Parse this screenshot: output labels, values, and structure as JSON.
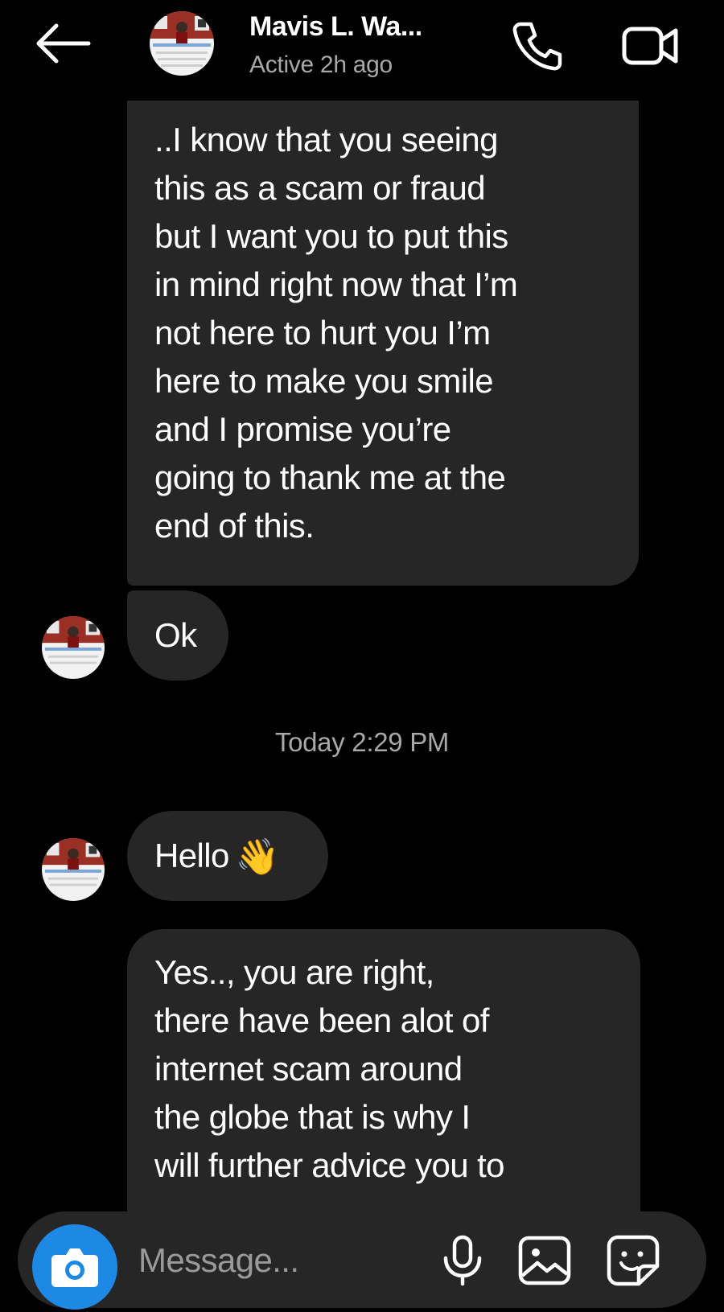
{
  "header": {
    "contact_name": "Mavis L. Wa...",
    "status": "Active 2h ago"
  },
  "icons": {
    "back": "arrow-left-icon",
    "call": "phone-icon",
    "video": "video-camera-icon",
    "camera": "camera-icon",
    "mic": "microphone-icon",
    "gallery": "image-icon",
    "sticker": "sticker-icon"
  },
  "messages": [
    {
      "sender": "contact",
      "lines": [
        "..I know that you seeing",
        "this as a scam or fraud",
        "but I want you to put this",
        "in mind right now that I’m",
        "not here to hurt you I’m",
        "here to make you smile",
        "and I promise you’re",
        "going to thank me at the",
        "end of this."
      ]
    },
    {
      "sender": "contact",
      "text": "Ok"
    },
    {
      "sender": "contact",
      "text": "Hello",
      "emoji": "👋"
    },
    {
      "sender": "contact",
      "lines": [
        "Yes.., you are right,",
        "there have been alot of",
        "internet scam around",
        "the globe that is why I",
        "will further advice you to"
      ]
    }
  ],
  "timestamp": "Today 2:29 PM",
  "composer": {
    "placeholder": "Message..."
  },
  "colors": {
    "background": "#000000",
    "bubble": "#262626",
    "accent": "#1e88e5",
    "secondary_text": "#a8a8a8"
  }
}
